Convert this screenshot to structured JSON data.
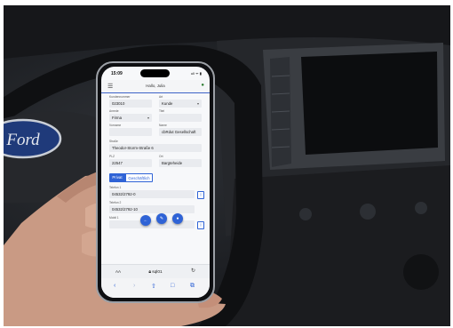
{
  "phone": {
    "time": "15:09",
    "status_icons": "ull ᯤ ▮",
    "header": {
      "greeting": "Hallo, Julia",
      "menu_icon": "hamburger-icon",
      "user_icon": "person-icon"
    },
    "form": {
      "kundennummer": {
        "label": "Kundennummer",
        "value": "023010"
      },
      "art": {
        "label": "Art",
        "value": "Kunde"
      },
      "anrede": {
        "label": "Anrede",
        "value": "Firma"
      },
      "titel": {
        "label": "Titel",
        "value": ""
      },
      "vorname": {
        "label": "Vorname",
        "value": ""
      },
      "name": {
        "label": "Name",
        "value": "cbRdut Gesellschaft"
      },
      "strasse": {
        "label": "Straße",
        "value": "Theodor-Storm-Straße 6"
      },
      "plz": {
        "label": "PLZ",
        "value": "22547"
      },
      "ort": {
        "label": "Ort",
        "value": "Bargteheide"
      },
      "tabs": [
        "Privat",
        "Geschäftlich"
      ],
      "telefon1": {
        "label": "Telefon 1",
        "value": "04532/2792-0"
      },
      "telefon2": {
        "label": "Telefon 2",
        "value": "04532/2792-10"
      },
      "mobil": {
        "label": "Mobil 1",
        "value": ""
      }
    },
    "fab_icons": [
      "arrow-left-icon",
      "pencil-icon",
      "binoculars-icon"
    ],
    "browser": {
      "text_size": "AA",
      "url": "sql01",
      "toolbar_icons": [
        "back-icon",
        "forward-icon",
        "share-icon",
        "bookmarks-icon",
        "tabs-icon"
      ]
    }
  },
  "scene": {
    "background": "car dashboard interior",
    "steering_wheel_logo": "Ford"
  },
  "colors": {
    "accent": "#2f63d6",
    "user_icon": "#2e7d32",
    "phone_frame": "#9ca0a6"
  }
}
